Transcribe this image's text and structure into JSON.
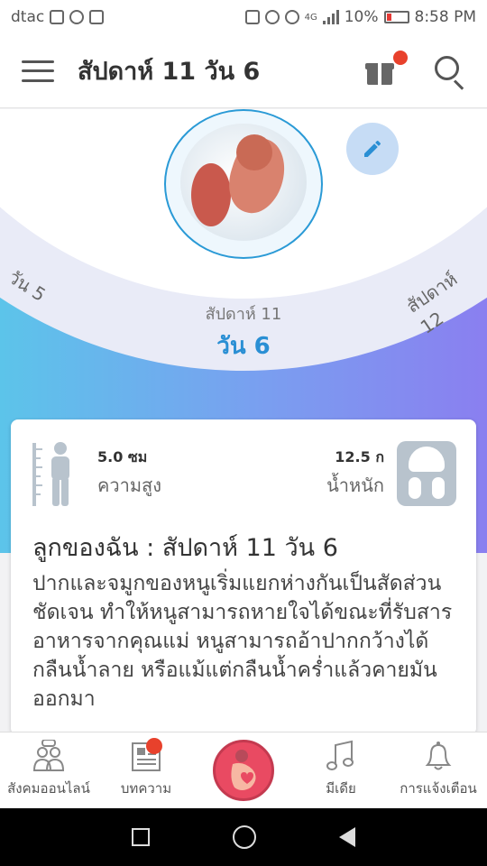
{
  "status_bar": {
    "carrier": "dtac",
    "network": "4G",
    "battery": "10%",
    "time": "8:58 PM"
  },
  "header": {
    "title": "สัปดาห์ 11 วัน 6",
    "menu_icon": "hamburger-menu-icon",
    "gift_icon": "gift-icon",
    "search_icon": "search-icon"
  },
  "hero": {
    "prev_day": "วัน 5",
    "next_week": "สัปดาห์ 12",
    "week_label": "สัปดาห์ 11",
    "day_label": "วัน 6",
    "edit_icon": "pencil-icon"
  },
  "card": {
    "height_value": "5.0 ซม",
    "height_label": "ความสูง",
    "weight_value": "12.5 ก",
    "weight_label": "น้ำหนัก",
    "title": "ลูกของฉัน : สัปดาห์ 11 วัน 6",
    "body": "ปากและจมูกของหนูเริ่มแยกห่างกันเป็นสัดส่วนชัดเจน ทำให้หนูสามารถหายใจได้ขณะที่รับสารอาหารจากคุณแม่ หนูสามารถอ้าปากกว้างได้ กลืนน้ำลาย หรือแม้แต่กลืนน้ำคร่ำแล้วคายมันออกมา"
  },
  "bottom_nav": {
    "items": [
      {
        "label": "สังคมออนไลน์",
        "icon": "community-icon"
      },
      {
        "label": "บทความ",
        "icon": "article-icon"
      },
      {
        "label": "",
        "icon": "pregnancy-icon"
      },
      {
        "label": "มีเดีย",
        "icon": "music-icon"
      },
      {
        "label": "การแจ้งเตือน",
        "icon": "bell-icon"
      }
    ]
  },
  "colors": {
    "accent": "#2a8fd4",
    "badge": "#e8412c",
    "center_button": "#e94a62"
  }
}
